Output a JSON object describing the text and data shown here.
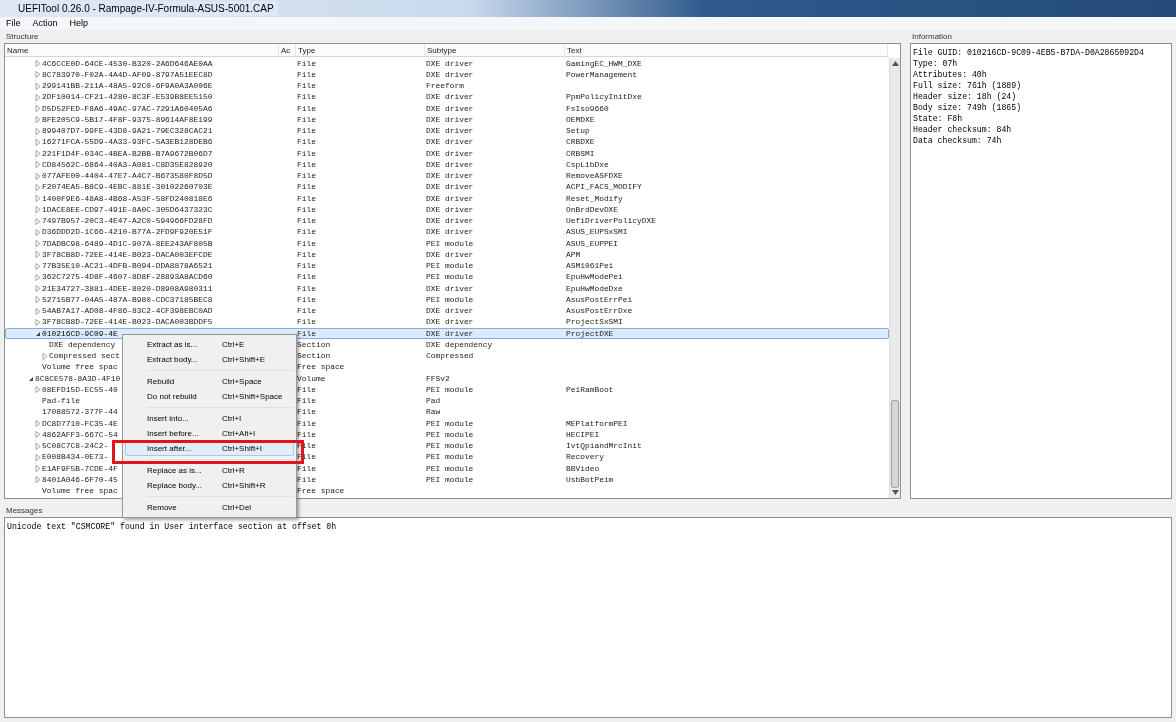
{
  "window": {
    "title": "UEFITool 0.26.0 - Rampage-IV-Formula-ASUS-5001.CAP"
  },
  "menu_bar": [
    "File",
    "Action",
    "Help"
  ],
  "structure": {
    "label": "Structure",
    "columns": [
      "Name",
      "Ac",
      "Type",
      "Subtype",
      "Text"
    ],
    "items": [
      {
        "children": [
          {
            "name": "4C6CCE0D-64CE-4530-B320-2A6D646AE0AA",
            "type": "File",
            "subtype": "DXE driver",
            "text": "GamingEC_HWM_DXE",
            "expanded": false,
            "selected": false
          },
          {
            "name": "8C783970-F02A-4A4D-AF09-8797A51EEC8D",
            "type": "File",
            "subtype": "DXE driver",
            "text": "PowerManagement",
            "expanded": false,
            "selected": false
          },
          {
            "name": "299141BB-211A-48A5-92C0-6F9A0A3A006E",
            "type": "File",
            "subtype": "Freeform",
            "expanded": false,
            "selected": false
          },
          {
            "name": "2DF10014-CF21-4280-8C3F-E539B8EE5150",
            "type": "File",
            "subtype": "DXE driver",
            "text": "PpmPolicyInitDxe",
            "expanded": false,
            "selected": false
          },
          {
            "name": "D5D52FED-F8A6-49AC-97AC-7291A60405A6",
            "type": "File",
            "subtype": "DXE driver",
            "text": "FsIso9660",
            "expanded": false,
            "selected": false
          },
          {
            "name": "BFE205C9-5B17-4F8F-9375-89614AF8E199",
            "type": "File",
            "subtype": "DXE driver",
            "text": "OEMDXE",
            "expanded": false,
            "selected": false
          },
          {
            "name": "899407D7-99FE-43D8-9A21-79EC328CAC21",
            "type": "File",
            "subtype": "DXE driver",
            "text": "Setup",
            "expanded": false,
            "selected": false
          },
          {
            "name": "16271FCA-55D9-4A33-93FC-5A3EB128DEB6",
            "type": "File",
            "subtype": "DXE driver",
            "text": "CRBDXE",
            "expanded": false,
            "selected": false
          },
          {
            "name": "221F1D4F-034C-4BEA-B2BB-B7A9672B06D7",
            "type": "File",
            "subtype": "DXE driver",
            "text": "CRBSMI",
            "expanded": false,
            "selected": false
          },
          {
            "name": "CD84562C-6864-40A3-A081-C8D35E828920",
            "type": "File",
            "subtype": "DXE driver",
            "text": "CspLibDxe",
            "expanded": false,
            "selected": false
          },
          {
            "name": "077AFE00-4404-47E7-A4C7-B673580F8D5D",
            "type": "File",
            "subtype": "DXE driver",
            "text": "RemoveASFDXE",
            "expanded": false,
            "selected": false
          },
          {
            "name": "F2074EA5-B8C9-4EBC-881E-30102260703E",
            "type": "File",
            "subtype": "DXE driver",
            "text": "ACPI_FACS_MODIFY",
            "expanded": false,
            "selected": false
          },
          {
            "name": "1400F9E6-48A8-4B68-A53F-58FD240818E6",
            "type": "File",
            "subtype": "DXE driver",
            "text": "Reset_Modify",
            "expanded": false,
            "selected": false
          },
          {
            "name": "1DACE8EE-CD97-491E-8A0C-305D6437323C",
            "type": "File",
            "subtype": "DXE driver",
            "text": "OnBrdDevDXE",
            "expanded": false,
            "selected": false
          },
          {
            "name": "7497B957-20C3-4E47-A2C0-594966FD28FD",
            "type": "File",
            "subtype": "DXE driver",
            "text": "UefiDriverPolicyDXE",
            "expanded": false,
            "selected": false
          },
          {
            "name": "D36DDD2D-1C66-4210-B77A-2FD9F920E51F",
            "type": "File",
            "subtype": "DXE driver",
            "text": "ASUS_EUPSxSMI",
            "expanded": false,
            "selected": false
          },
          {
            "name": "7DADBC98-6489-4D1C-907A-8EE243AF805B",
            "type": "File",
            "subtype": "PEI module",
            "text": "ASUS_EUPPEI",
            "expanded": false,
            "selected": false
          },
          {
            "name": "3F78CB8D-72EE-414E-B023-DACA003EFCDE",
            "type": "File",
            "subtype": "DXE driver",
            "text": "APM",
            "expanded": false,
            "selected": false
          },
          {
            "name": "77B35E10-AC21-4DFB-B094-DDA8878A6521",
            "type": "File",
            "subtype": "PEI module",
            "text": "ASM1061Pei",
            "expanded": false,
            "selected": false
          },
          {
            "name": "362C7275-4D8F-4607-8D8F-28893A8ACD60",
            "type": "File",
            "subtype": "PEI module",
            "text": "EpuHwModePei",
            "expanded": false,
            "selected": false
          },
          {
            "name": "21E34727-3881-4DEE-8020-D8908A980311",
            "type": "File",
            "subtype": "DXE driver",
            "text": "EpuHwModeDxe",
            "expanded": false,
            "selected": false
          },
          {
            "name": "52715B77-04A5-487A-B980-CDC37185BEC8",
            "type": "File",
            "subtype": "PEI module",
            "text": "AsusPostErrPei",
            "expanded": false,
            "selected": false
          },
          {
            "name": "54AB7A17-AD08-4F86-83C2-4CF398EBC0AD",
            "type": "File",
            "subtype": "DXE driver",
            "text": "AsusPostErrDxe",
            "expanded": false,
            "selected": false
          },
          {
            "name": "3F78CB8D-72EE-414E-B023-DACA003BDDF5",
            "type": "File",
            "subtype": "DXE driver",
            "text": "ProjectSxSMI",
            "expanded": false,
            "selected": false
          },
          {
            "name": "010216CD-9C09-4E",
            "type": "File",
            "subtype": "DXE driver",
            "text": "ProjectDXE",
            "expanded": true,
            "selected": true,
            "children": [
              {
                "name": "DXE dependency",
                "type": "Section",
                "subtype": "DXE dependency",
                "selected": false
              },
              {
                "name": "Compressed sect",
                "type": "Section",
                "subtype": "Compressed",
                "expanded": false,
                "selected": false
              }
            ]
          },
          {
            "name": "Volume free spac",
            "type": "Free space",
            "selected": false
          }
        ]
      },
      {
        "name": "8C8CE578-8A3D-4F10",
        "type": "Volume",
        "subtype": "FFSv2",
        "expanded": true,
        "selected": false,
        "children": [
          {
            "name": "08EFD15D-EC55-40",
            "type": "File",
            "subtype": "PEI module",
            "text": "PeiRamBoot",
            "expanded": false,
            "selected": false
          },
          {
            "name": "Pad-file",
            "type": "File",
            "subtype": "Pad",
            "selected": false
          },
          {
            "name": "17088572-377F-44",
            "type": "File",
            "subtype": "Raw",
            "selected": false
          },
          {
            "name": "DC8D7710-FC35-4E",
            "type": "File",
            "subtype": "PEI module",
            "text": "MEPlatformPEI",
            "expanded": false,
            "selected": false
          },
          {
            "name": "4862AFF3-667C-54",
            "type": "File",
            "subtype": "PEI module",
            "text": "HECIPEI",
            "expanded": false,
            "selected": false
          },
          {
            "name": "5C08C7C8-24C2-",
            "type": "File",
            "subtype": "PEI module",
            "text": "IvtQpiandMrcInit",
            "expanded": false,
            "selected": false
          },
          {
            "name": "E008B434-0E73-",
            "type": "File",
            "subtype": "PEI module",
            "text": "Recovery",
            "expanded": false,
            "selected": false
          },
          {
            "name": "E1AF9F5B-7CDE-4F",
            "type": "File",
            "subtype": "PEI module",
            "text": "BBVideo",
            "expanded": false,
            "selected": false
          },
          {
            "name": "8401A046-6F70-45",
            "type": "File",
            "subtype": "PEI module",
            "text": "UsbBotPeim",
            "expanded": false,
            "selected": false
          },
          {
            "name": "Volume free spac",
            "type": "Free space",
            "selected": false
          }
        ]
      }
    ]
  },
  "context_menu": [
    {
      "kind": "item",
      "label": "Extract as is...",
      "shortcut": "Ctrl+E",
      "selected": false
    },
    {
      "kind": "item",
      "label": "Extract body...",
      "shortcut": "Ctrl+Shift+E",
      "selected": false
    },
    {
      "kind": "separator"
    },
    {
      "kind": "item",
      "label": "Rebuild",
      "shortcut": "Ctrl+Space",
      "selected": false
    },
    {
      "kind": "item",
      "label": "Do not rebuild",
      "shortcut": "Ctrl+Shift+Space",
      "selected": false
    },
    {
      "kind": "separator"
    },
    {
      "kind": "item",
      "label": "Insert into...",
      "shortcut": "Ctrl+I",
      "selected": false
    },
    {
      "kind": "item",
      "label": "Insert before...",
      "shortcut": "Ctrl+Alt+I",
      "selected": false
    },
    {
      "kind": "item",
      "label": "Insert after...",
      "shortcut": "Ctrl+Shift+I",
      "selected": true
    },
    {
      "kind": "separator"
    },
    {
      "kind": "item",
      "label": "Replace as is...",
      "shortcut": "Ctrl+R",
      "selected": false
    },
    {
      "kind": "item",
      "label": "Replace body...",
      "shortcut": "Ctrl+Shift+R",
      "selected": false
    },
    {
      "kind": "separator"
    },
    {
      "kind": "item",
      "label": "Remove",
      "shortcut": "Ctrl+Del",
      "selected": false
    }
  ],
  "information": {
    "label": "Information",
    "lines": [
      "File GUID: 010216CD-9C09-4EB5-B7DA-D0A2865092D4",
      "Type: 07h",
      "Attributes: 40h",
      "Full size: 761h (1889)",
      "Header size: 18h (24)",
      "Body size: 749h (1865)",
      "State: F8h",
      "Header checksum: 84h",
      "Data checksum: 74h"
    ]
  },
  "messages": {
    "label": "Messages",
    "lines": [
      "Unicode text \"CSMCORE\" found in User interface section at offset 0h"
    ]
  }
}
